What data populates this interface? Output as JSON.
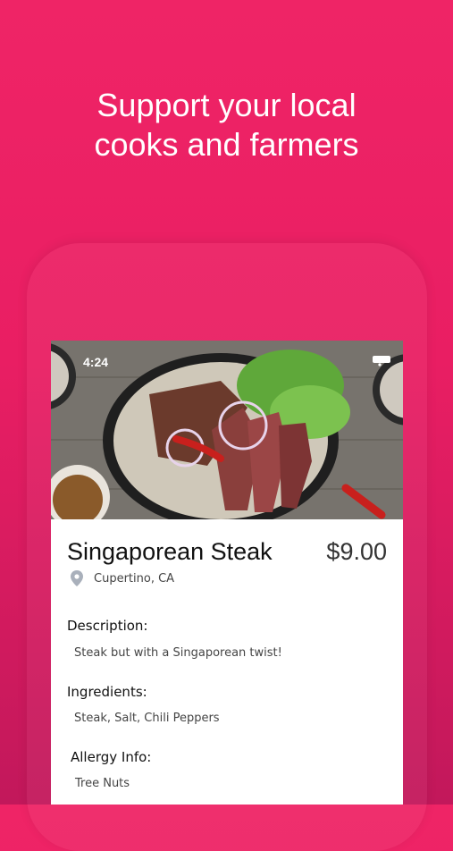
{
  "headline": {
    "line1": "Support your local",
    "line2": "cooks and farmers"
  },
  "status_bar": {
    "time": "4:24"
  },
  "dish": {
    "name": "Singaporean Steak",
    "price": "$9.00",
    "location": "Cupertino, CA"
  },
  "details": {
    "description_label": "Description:",
    "description_value": "Steak but with a Singaporean twist!",
    "ingredients_label": "Ingredients:",
    "ingredients_value": "Steak, Salt, Chili Peppers",
    "allergy_label": "Allergy Info:",
    "allergy_value": "Tree Nuts"
  },
  "colors": {
    "background": "#e91e63",
    "text_dark": "#111111",
    "icon_gray": "#a9b0bb"
  },
  "icons": {
    "location": "map-pin-icon",
    "wifi": "wifi-icon",
    "battery": "battery-icon"
  }
}
